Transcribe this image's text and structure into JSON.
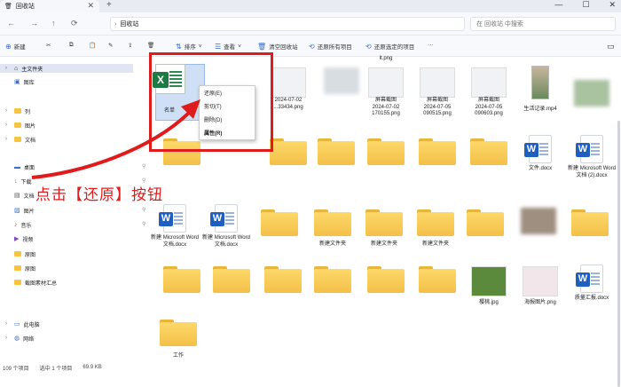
{
  "window": {
    "tab_title": "回收站",
    "tab_close": "✕",
    "new_tab": "+",
    "minimize": "—",
    "maximize": "☐",
    "close": "✕"
  },
  "address": {
    "back": "←",
    "forward": "→",
    "up": "↑",
    "refresh": "⟳",
    "path": "回收站",
    "search_placeholder": "在 回收站 中搜索"
  },
  "toolbar": {
    "new_label": "新建",
    "sort_label": "排序",
    "view_label": "查看",
    "empty_bin_label": "清空回收站",
    "restore_all_label": "还原所有项目",
    "restore_selected_label": "还原选定的项目",
    "more": "···"
  },
  "sidebar": {
    "items": [
      {
        "label": "主文件夹",
        "icon": "home-icon"
      },
      {
        "label": "图库",
        "icon": "gallery-icon"
      },
      {
        "label": "列",
        "icon": "folder-icon"
      },
      {
        "label": "图片",
        "icon": "folder-icon"
      },
      {
        "label": "文档",
        "icon": "folder-icon"
      },
      {
        "label": "桌面",
        "icon": "desktop-icon"
      },
      {
        "label": "下载",
        "icon": "download-icon"
      },
      {
        "label": "文档",
        "icon": "documents-icon"
      },
      {
        "label": "图片",
        "icon": "pictures-icon"
      },
      {
        "label": "音乐",
        "icon": "music-icon"
      },
      {
        "label": "视频",
        "icon": "video-icon"
      },
      {
        "label": "原图",
        "icon": "folder-icon"
      },
      {
        "label": "原图",
        "icon": "folder-icon"
      },
      {
        "label": "截图素材汇总",
        "icon": "folder-icon"
      },
      {
        "label": "此电脑",
        "icon": "pc-icon"
      },
      {
        "label": "网络",
        "icon": "network-icon"
      }
    ]
  },
  "context_menu": {
    "restore": "还原(E)",
    "cut": "剪切(T)",
    "delete": "删除(D)",
    "properties": "属性(R)"
  },
  "files": {
    "excel_name": "名单",
    "file_top": "lt.png",
    "shot1_name": "...33434.png",
    "shot1_date": "2024-07-02",
    "shot2_name": "屏幕截图",
    "shot2_date": "2024-07-02",
    "shot2_id": "170155.png",
    "shot3_name": "屏幕截图",
    "shot3_date": "2024-07-05",
    "shot3_id": "090515.png",
    "shot4_name": "屏幕截图",
    "shot4_date": "2024-07-05",
    "shot4_id": "090603.png",
    "video_name": "生活记录.mp4",
    "doc1": "文件.docx",
    "doc2": "新建 Microsoft Word 文档 (2).docx",
    "doc3": "新建 Microsoft Word 文档.docx",
    "doc4": "新建 Microsoft Word 文档.docx",
    "folder1": "新建文件夹",
    "folder2": "新建文件夹",
    "folder3": "新建文件夹",
    "img1": "樱桃.jpg",
    "img2": "海报图片.png",
    "doc5": "质量汇报.docx",
    "folder_work": "工作"
  },
  "callout_text": "点击【还原】按钮",
  "status": {
    "count": "109 个项目",
    "selected": "选中 1 个项目",
    "size": "69.9 KB"
  },
  "colors": {
    "highlight": "#e01b1b",
    "folder": "#f4c048",
    "word": "#1f5fbf",
    "excel": "#1d7a44"
  }
}
